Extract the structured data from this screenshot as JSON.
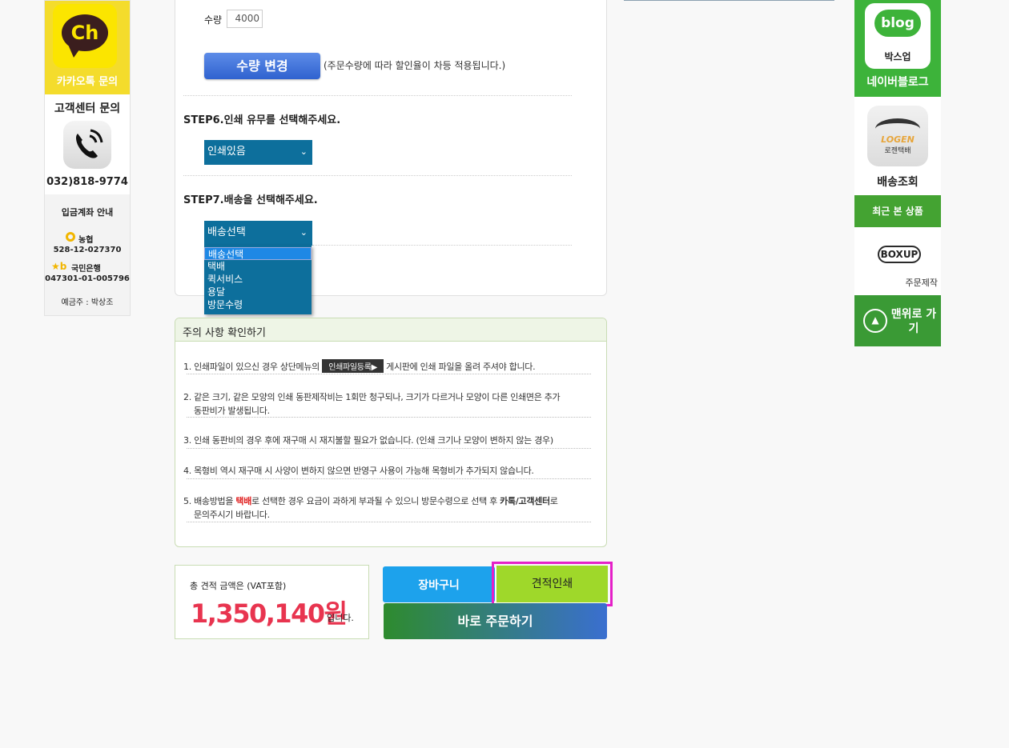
{
  "left_sidebar": {
    "kakao_icon_text": "Ch",
    "kakao_label": "카카오톡 문의",
    "cs_title": "고객센터 문의",
    "phone": "032)818-9774",
    "bank_title": "입금계좌 안내",
    "nh_name": "농협",
    "nh_account": "528-12-027370",
    "kb_logo": "★b",
    "kb_name": "국민은행",
    "kb_account": "047301-01-005796",
    "holder": "예금주 : 박상조"
  },
  "form": {
    "qty_label": "수량",
    "qty_value": "4000",
    "qty_button": "수량 변경",
    "qty_note": "(주문수량에 따라 할인율이 차등 적용됩니다.)",
    "step6_title": "STEP6.인쇄 유무를 선택해주세요.",
    "print_selected": "인쇄있음",
    "step7_title": "STEP7.배송을 선택해주세요.",
    "ship_selected": "배송선택",
    "ship_options": [
      "배송선택",
      "택배",
      "퀵서비스",
      "용달",
      "방문수령"
    ]
  },
  "notice": {
    "title": "주의 사항 확인하기",
    "n1_a": "1. 인쇄파일이 있으신 경우 상단메뉴의 ",
    "n1_badge": "인쇄파일등록▶",
    "n1_b": " 게시판에 인쇄 파일을 올려 주셔야 합니다.",
    "n2_a": "2. 같은 크기, 같은 모양의 인쇄 동판제작비는 1회만 청구되나, 크기가 다르거나 모양이 다른 인쇄면은 추가",
    "n2_b": "동판비가 발생됩니다.",
    "n3": "3. 인쇄 동판비의 경우 후에 재구매 시 재지불할 필요가 없습니다. (인쇄 크기나 모양이 변하지 않는 경우)",
    "n4": "4. 목형비 역시 재구매 시 사양이 변하지 않으면 반영구 사용이 가능해 목형비가 추가되지 않습니다.",
    "n5_a": "5. 배송방법을 ",
    "n5_red": "택배",
    "n5_b": "로 선택한 경우 요금이 과하게 부과될 수 있으니 방문수령으로 선택 후 ",
    "n5_bold": "카톡/고객센터",
    "n5_c": "로",
    "n5_d": "문의주시기 바랍니다."
  },
  "footer": {
    "total_label": "총 견적 금액은 (VAT포함)",
    "total_value": "1,350,140원",
    "total_suffix": "입니다.",
    "cart_button": "장바구니",
    "estimate_button": "견적인쇄",
    "order_button": "바로 주문하기"
  },
  "right_sidebar": {
    "blog_word": "blog",
    "blog_text": "박스업",
    "blog_label": "네이버블로그",
    "logen_name": "LOGEN",
    "logen_sub": "로젠택배",
    "tracking_label": "배송조회",
    "recent_head": "최근 본 상품",
    "boxup_logo": "BOXUP",
    "recent_caption": "주문제작",
    "top_button": "맨위로 가기"
  },
  "colors": {
    "accent_select": "#0d6f9c",
    "total_red": "#e8344f",
    "estimate_green": "#9fd82a",
    "cart_blue": "#1da2ec",
    "highlight_magenta": "#e520c8"
  }
}
